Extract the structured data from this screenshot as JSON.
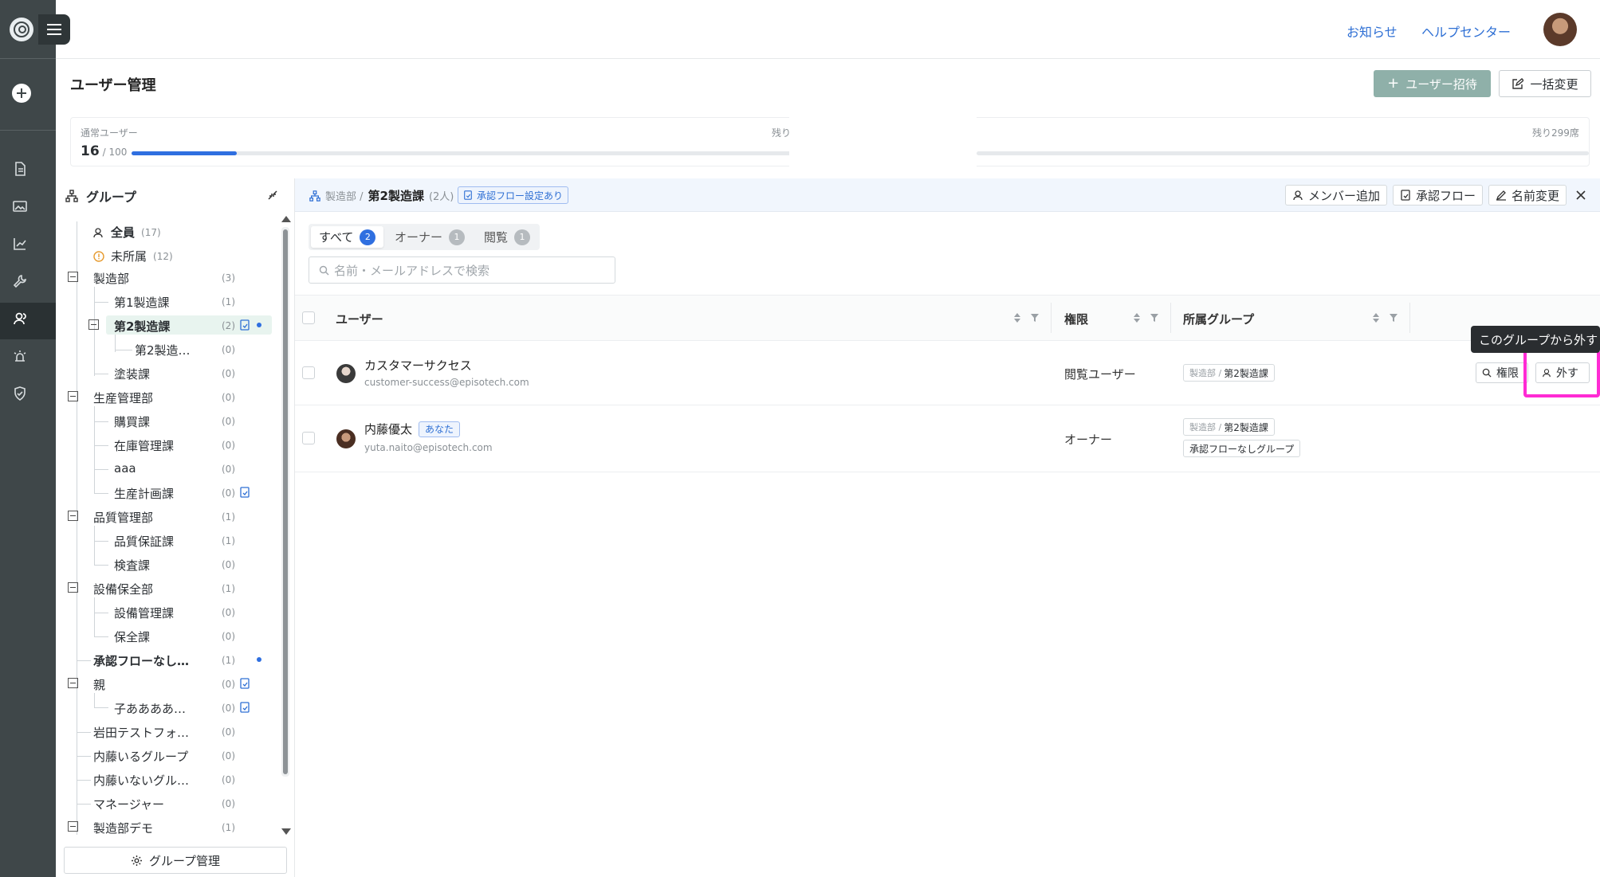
{
  "header": {
    "links": [
      "お知らせ",
      "ヘルプセンター"
    ],
    "page_title": "ユーザー管理",
    "invite_label": "ユーザー招待",
    "bulk_label": "一括変更"
  },
  "usage": {
    "label": "通常ユーザー",
    "current": "16",
    "total": "/ 100",
    "remaining_label": "残り",
    "remaining_seats": "残り299席",
    "progress": 0.16
  },
  "groups": {
    "title": "グループ",
    "manage_label": "グループ管理",
    "items": [
      {
        "label": "全員",
        "count": "(17)"
      },
      {
        "label": "未所属",
        "count": "(12)"
      },
      {
        "label": "製造部",
        "count": "(3)"
      },
      {
        "label": "第1製造課",
        "count": "(1)"
      },
      {
        "label": "第2製造課",
        "count": "(2)"
      },
      {
        "label": "第2製造…",
        "count": "(0)"
      },
      {
        "label": "塗装課",
        "count": "(0)"
      },
      {
        "label": "生産管理部",
        "count": "(0)"
      },
      {
        "label": "購買課",
        "count": "(0)"
      },
      {
        "label": "在庫管理課",
        "count": "(0)"
      },
      {
        "label": "aaa",
        "count": "(0)"
      },
      {
        "label": "生産計画課",
        "count": "(0)"
      },
      {
        "label": "品質管理部",
        "count": "(1)"
      },
      {
        "label": "品質保証課",
        "count": "(1)"
      },
      {
        "label": "検査課",
        "count": "(0)"
      },
      {
        "label": "設備保全部",
        "count": "(1)"
      },
      {
        "label": "設備管理課",
        "count": "(0)"
      },
      {
        "label": "保全課",
        "count": "(0)"
      },
      {
        "label": "承認フローなし…",
        "count": "(1)"
      },
      {
        "label": "親",
        "count": "(0)"
      },
      {
        "label": "子ああああ…",
        "count": "(0)"
      },
      {
        "label": "岩田テストフォ…",
        "count": "(0)"
      },
      {
        "label": "内藤いるグループ",
        "count": "(0)"
      },
      {
        "label": "内藤いないグル…",
        "count": "(0)"
      },
      {
        "label": "マネージャー",
        "count": "(0)"
      },
      {
        "label": "製造部デモ",
        "count": "(1)"
      }
    ]
  },
  "detail": {
    "breadcrumb_parent": "製造部 /",
    "group_name": "第2製造課",
    "member_count": "(2人)",
    "flow_tag": "承認フロー設定あり",
    "btn_add_member": "メンバー追加",
    "btn_flow": "承認フロー",
    "btn_rename": "名前変更",
    "tabs": [
      {
        "label": "すべて",
        "count": "2"
      },
      {
        "label": "オーナー",
        "count": "1"
      },
      {
        "label": "閲覧",
        "count": "1"
      }
    ],
    "search_placeholder": "名前・メールアドレスで検索",
    "columns": {
      "user": "ユーザー",
      "role": "権限",
      "groups": "所属グループ"
    },
    "rows": [
      {
        "name": "カスタマーサクセス",
        "email": "customer-success@episotech.com",
        "role": "閲覧ユーザー",
        "tags": [
          {
            "pre": "製造部 /",
            "name": "第2製造課"
          }
        ],
        "btn_role": "権限",
        "btn_remove": "外す"
      },
      {
        "name": "内藤優太",
        "you": "あなた",
        "email": "yuta.naito@episotech.com",
        "role": "オーナー",
        "tags": [
          {
            "pre": "製造部 /",
            "name": "第2製造課"
          },
          {
            "pre": "",
            "name": "承認フローなしグループ"
          }
        ]
      }
    ],
    "tooltip": "このグループから外す"
  },
  "colors": {
    "accent": "#2f6fe0",
    "rail": "#3f4749",
    "highlight": "#ff2bd4",
    "invite": "#8fb0a9"
  }
}
